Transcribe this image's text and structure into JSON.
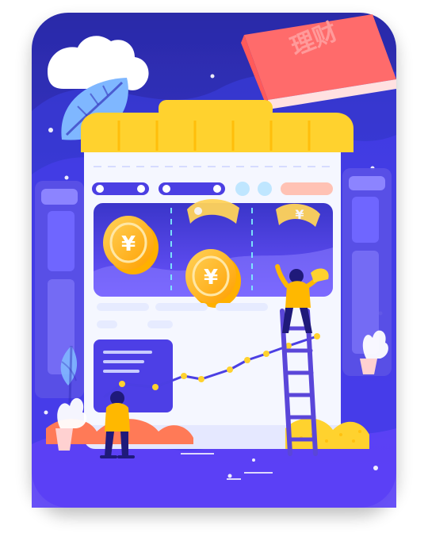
{
  "illustration": {
    "book_title": "理财",
    "currency_symbol": "¥",
    "colors": {
      "background": "#4338d8",
      "card_bg_top": "#2f2fb6",
      "card_bg_bottom": "#5b2ee8",
      "window_frame": "#f2f5ff",
      "window_header": "#ffd22e",
      "coin": "#ffb800",
      "ladder": "#5a46d9",
      "book": "#ff6b6b",
      "leaf": "#7db6ff",
      "accent_yellow": "#ffd22e",
      "accent_coral": "#ff7a57"
    }
  }
}
